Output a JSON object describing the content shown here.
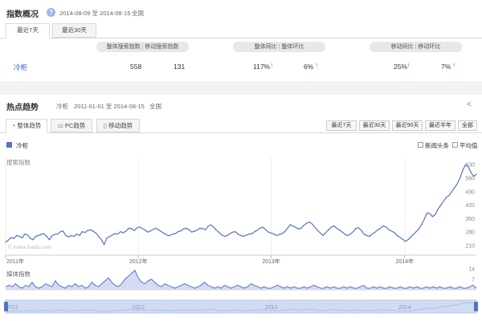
{
  "overview": {
    "title": "指数概况",
    "date_range": "2014-08-09 至 2014-08-15",
    "region": "全国",
    "tabs": [
      "最近7天",
      "最近30天"
    ],
    "col_headers": [
      "整体搜索指数",
      "移动搜索指数",
      "整体同比",
      "整体环比",
      "移动同比",
      "移动环比"
    ],
    "row": {
      "keyword": "冷柜",
      "overall_index": "558",
      "mobile_index": "131",
      "overall_yoy": "117%",
      "overall_mom": "6%",
      "mobile_yoy": "25%",
      "mobile_mom": "7%"
    }
  },
  "trend": {
    "title": "热点趋势",
    "keyword": "冷柜",
    "date_range": "2011-01-01 至 2014-08-15",
    "region": "全国",
    "tabs": [
      "整体趋势",
      "PC趋势",
      "移动趋势"
    ],
    "range_buttons": [
      "最近7天",
      "最近30天",
      "最近90天",
      "最近半年",
      "全部"
    ],
    "legend_series": "冷柜",
    "options": [
      "新闻头条",
      "平均值"
    ],
    "search_label": "搜索指数",
    "watermark": "© index.baidu.com",
    "media_label": "媒体指数",
    "accent": "#5873c3",
    "arrow_color": "#e1602c"
  },
  "chart_data": [
    {
      "type": "line",
      "ylabel": "搜索指数",
      "ylim": [
        160,
        660
      ],
      "yticks": [
        210,
        280,
        350,
        420,
        490,
        560,
        630
      ],
      "xticks": [
        "2011年",
        "2012年",
        "2013年",
        "2014年"
      ],
      "series": [
        {
          "name": "冷柜",
          "values": [
            228,
            238,
            252,
            246,
            262,
            258,
            250,
            270,
            265,
            248,
            240,
            258,
            262,
            268,
            272,
            258,
            240,
            262,
            268,
            270,
            282,
            285,
            262,
            255,
            262,
            258,
            270,
            262,
            282,
            278,
            288,
            292,
            284,
            275,
            258,
            240,
            215,
            250,
            256,
            265,
            272,
            270,
            282,
            276,
            286,
            300,
            298,
            288,
            302,
            306,
            298,
            290,
            280,
            286,
            295,
            300,
            290,
            282,
            272,
            264,
            262,
            270,
            272,
            282,
            286,
            296,
            300,
            292,
            280,
            285,
            290,
            300,
            298,
            292,
            310,
            318,
            306,
            290,
            278,
            265,
            258,
            262,
            272,
            280,
            282,
            268,
            262,
            258,
            264,
            270,
            272,
            282,
            290,
            300,
            306,
            292,
            280,
            275,
            270,
            262,
            268,
            272,
            282,
            300,
            318,
            312,
            304,
            296,
            300,
            316,
            326,
            332,
            322,
            305,
            288,
            275,
            262,
            278,
            292,
            306,
            312,
            300,
            290,
            280,
            268,
            262,
            270,
            282,
            300,
            302,
            288,
            268,
            262,
            258,
            270,
            280,
            292,
            300,
            312,
            306,
            292,
            285,
            278,
            262,
            254,
            244,
            232,
            240,
            254,
            268,
            282,
            296,
            320,
            348,
            380,
            376,
            360,
            372,
            400,
            420,
            440,
            460,
            470,
            490,
            510,
            530,
            560,
            600,
            630,
            620,
            590,
            570,
            580
          ]
        }
      ]
    },
    {
      "type": "area",
      "ylabel": "媒体指数",
      "ylim": [
        0,
        14
      ],
      "yticks": [
        7,
        14
      ],
      "series": [
        {
          "name": "冷柜",
          "values": [
            2,
            3,
            2,
            4,
            2,
            1,
            3,
            2,
            5,
            2,
            1,
            2,
            4,
            3,
            2,
            6,
            3,
            2,
            1,
            3,
            2,
            4,
            2,
            3,
            1,
            2,
            5,
            3,
            2,
            4,
            6,
            8,
            5,
            3,
            2,
            4,
            7,
            9,
            11,
            13,
            8,
            5,
            4,
            6,
            7,
            5,
            3,
            2,
            4,
            3,
            2,
            1,
            2,
            3,
            4,
            3,
            2,
            1,
            2,
            3,
            5,
            3,
            2,
            1,
            2,
            1,
            3,
            2,
            1,
            2,
            3,
            2,
            1,
            2,
            4,
            3,
            2,
            1,
            2,
            1,
            1,
            2,
            3,
            2,
            1,
            2,
            1,
            2,
            1,
            1,
            2,
            1,
            2,
            3,
            2,
            1,
            1,
            2,
            1,
            2,
            1,
            1,
            2,
            1,
            2,
            1,
            1,
            2,
            3,
            1,
            1,
            2,
            1,
            2,
            1,
            1,
            2,
            1,
            1,
            2,
            1,
            1,
            2,
            1,
            2,
            1,
            1,
            2,
            1,
            2,
            1,
            2,
            1,
            1,
            2,
            1,
            1,
            2,
            1,
            1,
            2,
            3,
            1
          ]
        }
      ]
    },
    {
      "type": "area",
      "xticks": [
        "2011",
        "2012",
        "2013",
        "2014"
      ]
    }
  ]
}
